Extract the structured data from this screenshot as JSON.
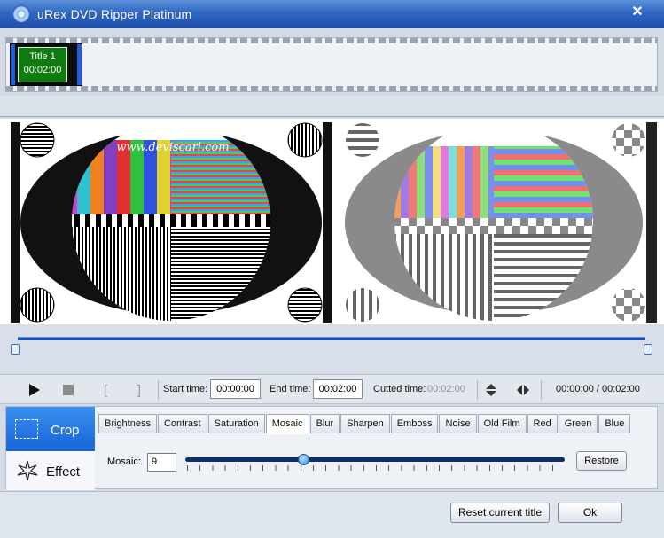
{
  "window": {
    "title": "uRex DVD Ripper Platinum",
    "close_glyph": "✕",
    "app_icon": "dvd-disc-icon"
  },
  "titles": [
    {
      "name": "Title 1",
      "duration": "00:02:00"
    }
  ],
  "preview": {
    "watermark": "www.deviscarl.com"
  },
  "controls": {
    "start_label": "Start time:",
    "start_value": "00:00:00",
    "end_label": "End time:",
    "end_value": "00:02:00",
    "cutted_label": "Cutted time:",
    "cutted_value": "00:02:00",
    "position": "00:00:00 / 00:02:00",
    "mark_in_glyph": "[",
    "mark_out_glyph": "]"
  },
  "sidebar": {
    "crop_label": "Crop",
    "effect_label": "Effect",
    "active": "crop"
  },
  "tabs": [
    "Brightness",
    "Contrast",
    "Saturation",
    "Mosaic",
    "Blur",
    "Sharpen",
    "Emboss",
    "Noise",
    "Old Film",
    "Red",
    "Green",
    "Blue"
  ],
  "active_tab": "Mosaic",
  "mosaic": {
    "label": "Mosaic:",
    "value": "9",
    "slider_fraction": 0.31
  },
  "buttons": {
    "restore": "Restore",
    "reset": "Reset current title",
    "ok": "Ok"
  },
  "colors": {
    "accent": "#1665d8",
    "title_bar": "#2f66c2",
    "title_thumb": "#0f7a0f"
  }
}
